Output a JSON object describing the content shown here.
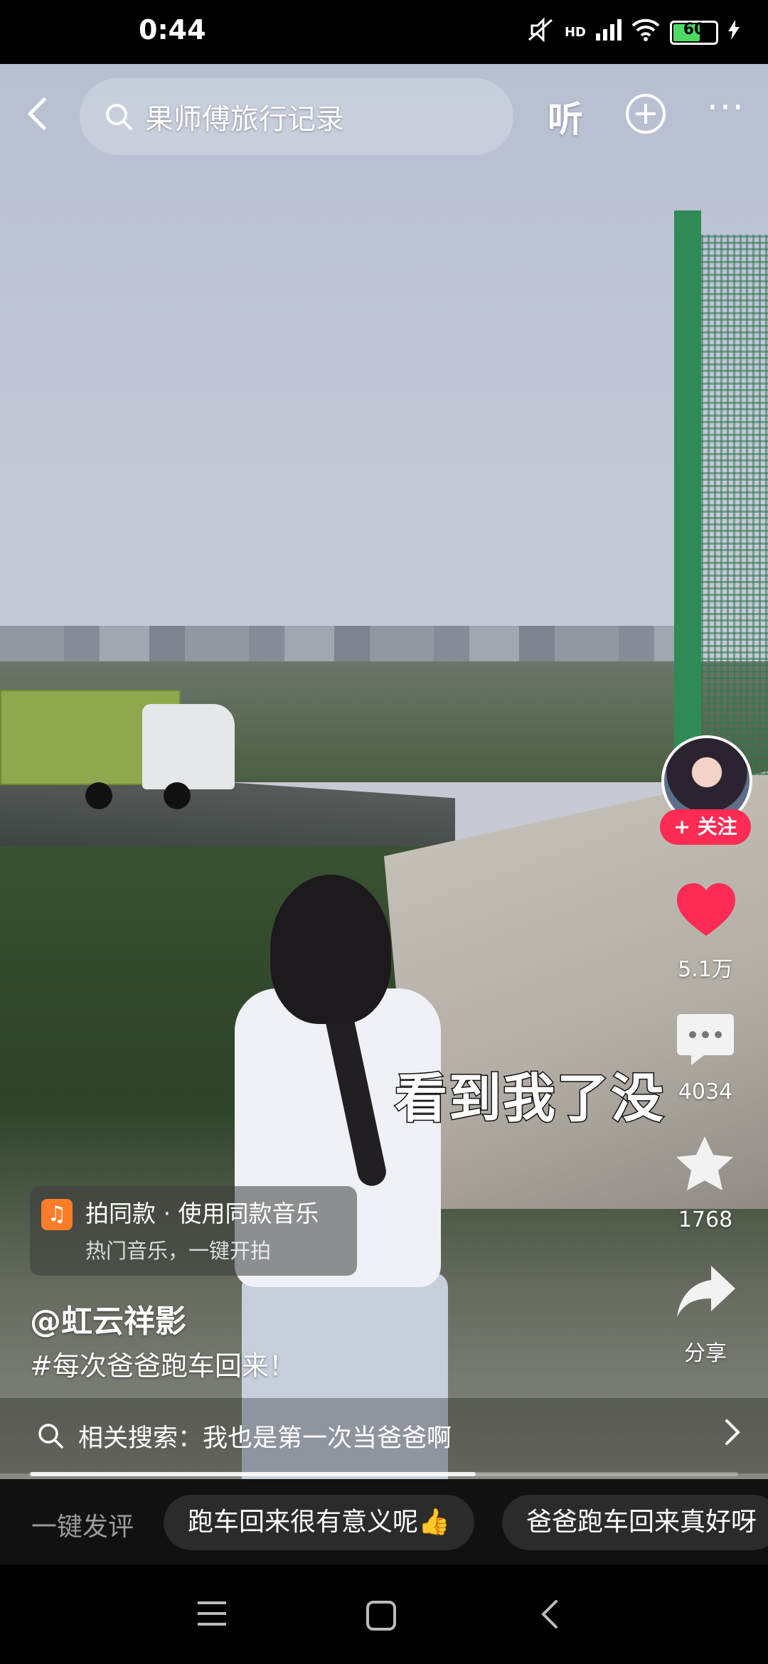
{
  "status_bar": {
    "time": "0:44",
    "network": "HD",
    "battery": "60"
  },
  "top_bar": {
    "search_text": "果师傅旅行记录",
    "listen_label": "听"
  },
  "video": {
    "subtitle": "看到我了没"
  },
  "right_rail": {
    "follow_label": "+ 关注",
    "likes": "5.1万",
    "comments": "4034",
    "favorites": "1768",
    "share_label": "分享"
  },
  "music_card": {
    "line1": "拍同款 · 使用同款音乐",
    "line2": "热门音乐，一键开拍"
  },
  "post": {
    "author": "@虹云祥影",
    "description": "#每次爸爸跑车回来！"
  },
  "related_search": {
    "text": "相关搜索：我也是第一次当爸爸啊"
  },
  "progress": 0.63,
  "comment_bar": {
    "hint": "一键发评",
    "chips": [
      "跑车回来很有意义呢👍",
      "爸爸跑车回来真好呀"
    ]
  },
  "colors": {
    "accent": "#fe2c55",
    "like": "#fe2c55",
    "music_icon": "#ff7d29"
  }
}
